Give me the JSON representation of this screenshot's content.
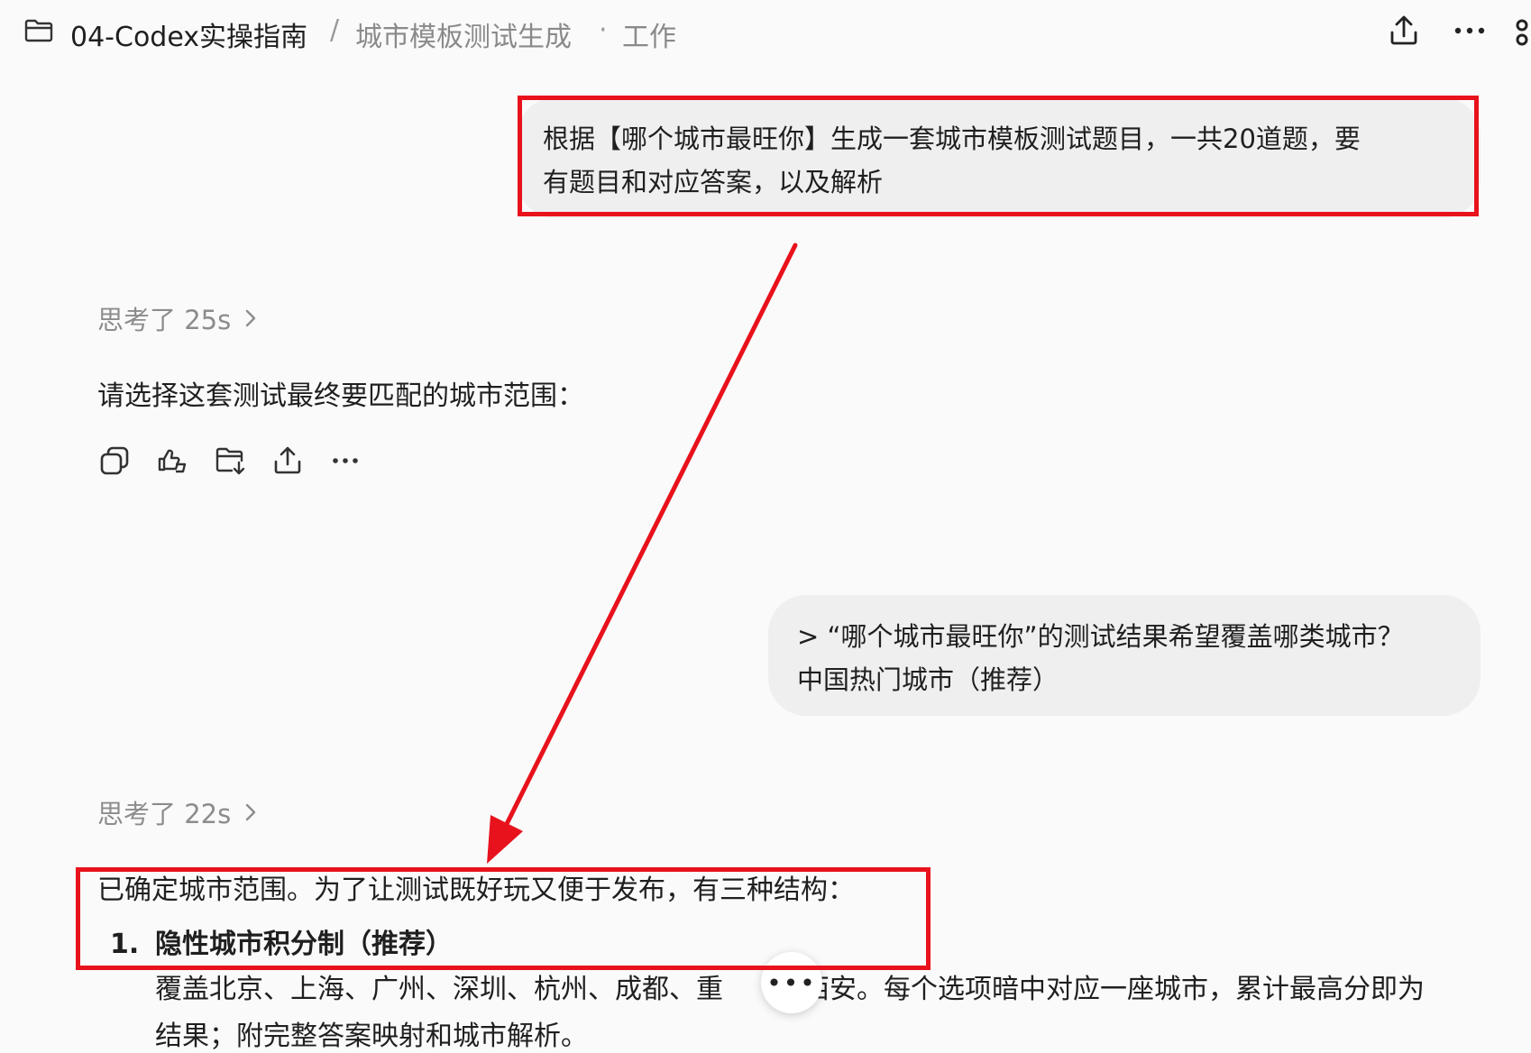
{
  "header": {
    "project": "04-Codex实操指南",
    "separator": "/",
    "chat_title": "城市模板测试生成",
    "dot": "·",
    "mode": "工作",
    "icons": [
      "folder-icon",
      "share-icon",
      "more-icon"
    ]
  },
  "messages": {
    "user_1": {
      "line_1": "根据【哪个城市最旺你】生成一套城市模板测试题目，一共20道题，要",
      "line_2": "有题目和对应答案，以及解析"
    },
    "thought_1": "思考了 25s",
    "assistant_1": "请选择这套测试最终要匹配的城市范围：",
    "actions": [
      "copy-icon",
      "thumbs-icon",
      "folder-add-icon",
      "share-icon",
      "more-icon"
    ],
    "user_2": {
      "line_1": "> “哪个城市最旺你”的测试结果希望覆盖哪类城市？",
      "line_2": "中国热门城市（推荐）"
    },
    "thought_2": "思考了 22s",
    "assistant_2": "已确定城市范围。为了让测试既好玩又便于发布，有三种结构：",
    "list": {
      "number": "1.",
      "title": "隐性城市积分制（推荐）",
      "desc_line_1": "覆盖北京、上海、广州、深圳、杭州、成都、重",
      "desc_line_1b": "西安。每个选项暗中对应一座城市，累计最高分即为",
      "desc_line_2": "结果；附完整答案映射和城市解析。"
    }
  },
  "floating_button": "•••",
  "annotation_color": "#e8121c"
}
